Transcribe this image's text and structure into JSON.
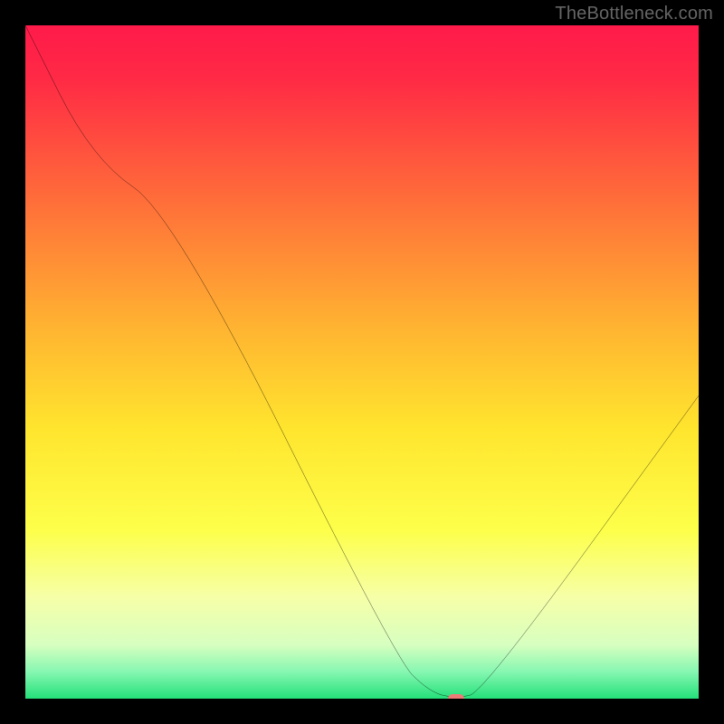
{
  "watermark": "TheBottleneck.com",
  "chart_data": {
    "type": "line",
    "title": "",
    "xlabel": "",
    "ylabel": "",
    "xlim": [
      0,
      100
    ],
    "ylim": [
      0,
      100
    ],
    "x": [
      0,
      10,
      22,
      55,
      60,
      64,
      68,
      100
    ],
    "values": [
      100,
      80,
      72,
      6,
      1,
      0,
      1,
      45
    ],
    "marker": {
      "x": 64,
      "y": 0
    },
    "gradient_stops": [
      {
        "pct": 0,
        "color": "#ff1a4a"
      },
      {
        "pct": 8,
        "color": "#ff2a45"
      },
      {
        "pct": 25,
        "color": "#ff6a3a"
      },
      {
        "pct": 45,
        "color": "#ffb431"
      },
      {
        "pct": 60,
        "color": "#ffe52e"
      },
      {
        "pct": 75,
        "color": "#fdff4a"
      },
      {
        "pct": 85,
        "color": "#f6ffa8"
      },
      {
        "pct": 92,
        "color": "#d7ffc0"
      },
      {
        "pct": 96,
        "color": "#86f7b1"
      },
      {
        "pct": 100,
        "color": "#24e07a"
      }
    ]
  }
}
